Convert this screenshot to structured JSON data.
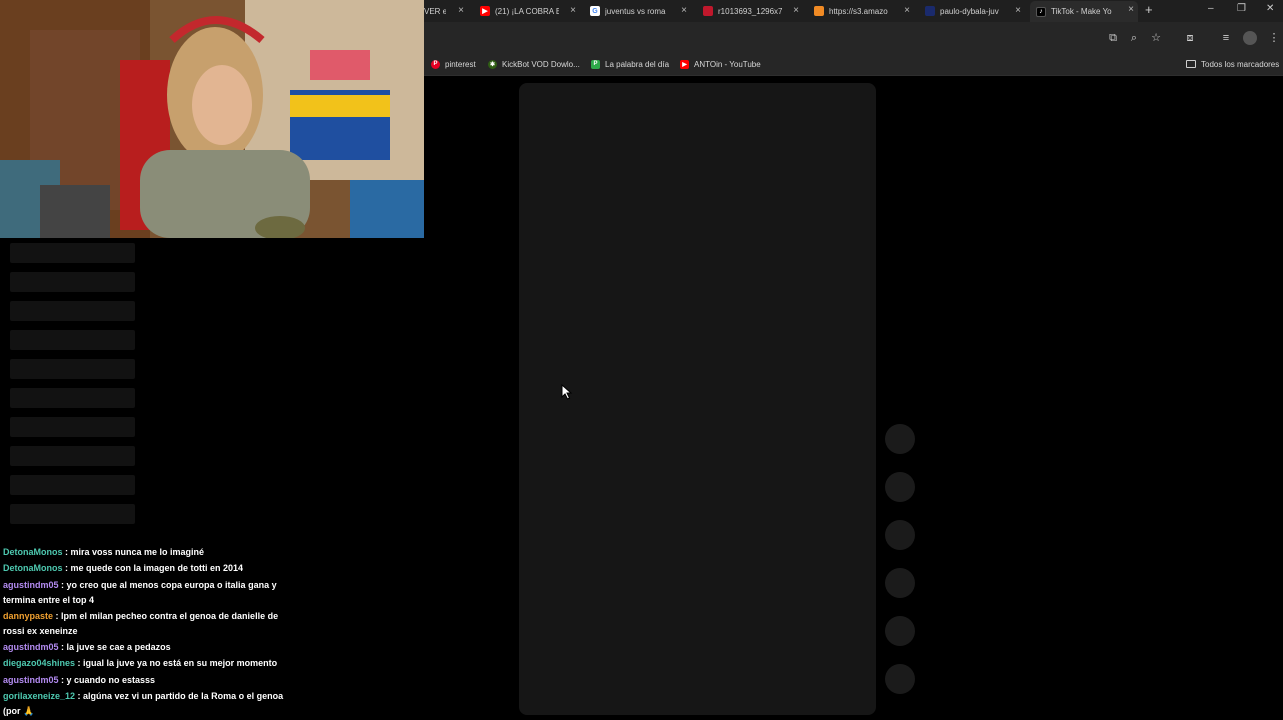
{
  "browser": {
    "tabs": [
      {
        "title": "VER en",
        "favicon": "red",
        "active": false
      },
      {
        "title": "(21) ¡LA COBRA E",
        "favicon": "youtube",
        "active": false
      },
      {
        "title": "juventus vs roma",
        "favicon": "google",
        "active": false
      },
      {
        "title": "r1013693_1296x7",
        "favicon": "red",
        "active": false
      },
      {
        "title": "https://s3.amazo",
        "favicon": "orange",
        "active": false
      },
      {
        "title": "paulo-dybala-juv",
        "favicon": "dark",
        "active": false
      },
      {
        "title": "TikTok - Make Yo",
        "favicon": "tiktok",
        "active": true
      }
    ],
    "new_tab": "+",
    "window": {
      "minimize": "–",
      "restore": "❐",
      "close": "✕"
    },
    "bookmarks": [
      {
        "label": "pinterest",
        "color": "#e60023"
      },
      {
        "label": "KickBot VOD Dowlo...",
        "color": "#53fc18"
      },
      {
        "label": "La palabra del día",
        "color": "#2eaa4a"
      },
      {
        "label": "ANTOin - YouTube",
        "color": "#ff0000"
      }
    ],
    "all_bookmarks": "Todos los marcadores"
  },
  "chat": [
    {
      "user": "DetonaMonos",
      "color": "#4ec9b0",
      "text": "mira voss nunca me lo imaginé"
    },
    {
      "user": "DetonaMonos",
      "color": "#4ec9b0",
      "text": "me quede con la imagen de totti en 2014"
    },
    {
      "user": "agustindm05",
      "color": "#b48cf2",
      "text": "yo creo que al menos copa europa o italia gana y termina entre el top 4"
    },
    {
      "user": "dannypaste",
      "color": "#f0a030",
      "text": "lpm el milan pecheo contra el genoa de danielle de rossi ex xeneinze"
    },
    {
      "user": "agustindm05",
      "color": "#b48cf2",
      "text": "la juve se cae a pedazos"
    },
    {
      "user": "diegazo04shines",
      "color": "#4ec9b0",
      "text": "igual la juve ya no está en su mejor momento"
    },
    {
      "user": "agustindm05",
      "color": "#b48cf2",
      "text": "y cuando no estasss"
    },
    {
      "user": "gorilaxeneize_12",
      "color": "#4ec9b0",
      "text": "algúna vez vi un partido de la Roma o el genoa (por 🙏"
    }
  ]
}
